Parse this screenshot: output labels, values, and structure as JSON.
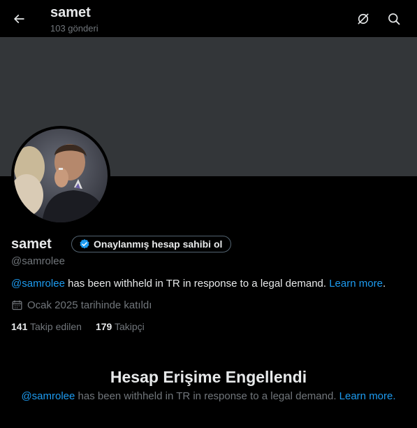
{
  "header": {
    "title": "samet",
    "post_count": "103 gönderi",
    "icons": [
      "back-arrow-icon",
      "grok-icon",
      "search-icon"
    ]
  },
  "profile": {
    "name": "samet",
    "verify_label": "Onaylanmış hesap sahibi ol",
    "handle": "@samrolee",
    "withheld": {
      "mention": "@samrolee",
      "text": " has been withheld in TR in response to a legal demand. ",
      "link": "Learn more",
      "end": "."
    },
    "joined": "Ocak 2025 tarihinde katıldı",
    "following_count": "141",
    "following_label": "Takip edilen",
    "followers_count": "179",
    "followers_label": "Takipçi"
  },
  "blocked": {
    "title": "Hesap Erişime Engellendi",
    "mention": "@samrolee",
    "text": " has been withheld in TR in response to a legal demand. ",
    "link": "Learn more",
    "end": "."
  },
  "colors": {
    "background": "#000000",
    "banner": "#333639",
    "link": "#1d9bf0",
    "secondary_text": "#71767b",
    "verified_badge": "#1d9bf0"
  }
}
